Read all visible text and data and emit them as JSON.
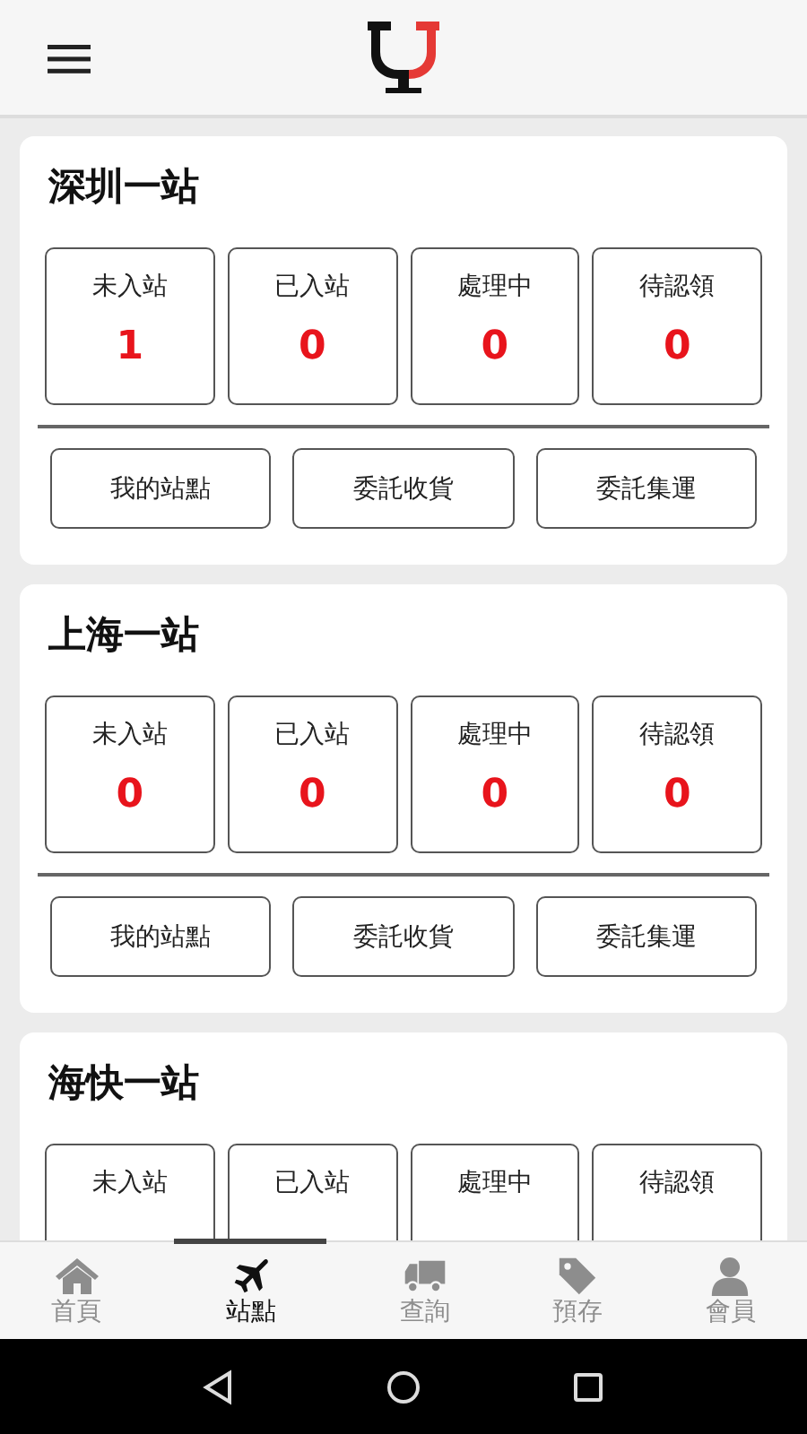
{
  "stations": [
    {
      "name": "深圳一站",
      "stats": [
        {
          "label": "未入站",
          "value": "1"
        },
        {
          "label": "已入站",
          "value": "0"
        },
        {
          "label": "處理中",
          "value": "0"
        },
        {
          "label": "待認領",
          "value": "0"
        }
      ],
      "actions": [
        "我的站點",
        "委託收貨",
        "委託集運"
      ]
    },
    {
      "name": "上海一站",
      "stats": [
        {
          "label": "未入站",
          "value": "0"
        },
        {
          "label": "已入站",
          "value": "0"
        },
        {
          "label": "處理中",
          "value": "0"
        },
        {
          "label": "待認領",
          "value": "0"
        }
      ],
      "actions": [
        "我的站點",
        "委託收貨",
        "委託集運"
      ]
    },
    {
      "name": "海快一站",
      "stats": [
        {
          "label": "未入站"
        },
        {
          "label": "已入站"
        },
        {
          "label": "處理中"
        },
        {
          "label": "待認領"
        }
      ]
    }
  ],
  "bottom_nav": [
    {
      "kind": "home",
      "label": "首頁",
      "selected": false
    },
    {
      "kind": "plane",
      "label": "站點",
      "selected": true
    },
    {
      "kind": "truck",
      "label": "查詢",
      "selected": false
    },
    {
      "kind": "tag",
      "label": "預存",
      "selected": false
    },
    {
      "kind": "user",
      "label": "會員",
      "selected": false
    }
  ]
}
